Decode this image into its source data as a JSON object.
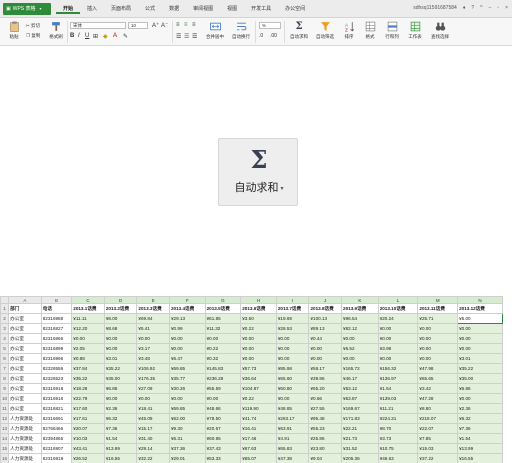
{
  "titlebar": {
    "app_name": "WPS 表格",
    "tabs": [
      "开始",
      "插入",
      "页面布局",
      "公式",
      "数据",
      "审阅视图",
      "视图",
      "开发工具",
      "办公空间"
    ],
    "active_tab": "开始",
    "right_text": "sdhsq11591687584"
  },
  "ribbon": {
    "paste": "粘贴",
    "cut": "剪切",
    "copy": "复制",
    "format_painter": "格式刷",
    "font_name": "宋体",
    "font_size": "10",
    "merge_center": "合并居中",
    "wrap_text": "自动换行",
    "number_format": "%",
    "autosum": "自动求和",
    "autofilter": "自动筛选",
    "sort": "排序",
    "format": "格式",
    "rows_cols": "行和列",
    "worksheet": "工作表",
    "find_select": "查找选择"
  },
  "zoomed_button": {
    "symbol": "Σ",
    "label": "自动求和",
    "caret": "▾"
  },
  "sheet": {
    "col_letters": [
      "A",
      "B",
      "C",
      "D",
      "E",
      "F",
      "G",
      "H",
      "I",
      "J",
      "K",
      "L",
      "M",
      "N"
    ],
    "header": [
      "部门",
      "电话",
      "2013.1话费",
      "2013.2话费",
      "2013.3话费",
      "2013.4话费",
      "2013.5话费",
      "2013.6话费",
      "2013.7话费",
      "2013.8话费",
      "2013.9话费",
      "2013.10话费",
      "2013.11话费",
      "2013.12话费"
    ],
    "rows": [
      [
        "办公室",
        "82316988",
        "¥11.11",
        "¥6.00",
        "¥69.84",
        "¥29.13",
        "¥61.85",
        "¥3.50",
        "¥19.69",
        "¥100.13",
        "¥96.54",
        "¥20.24",
        "¥25.71",
        "¥6.00"
      ],
      [
        "办公室",
        "82316827",
        "¥12.20",
        "¥8.68",
        "¥5.41",
        "¥0.99",
        "¥11.32",
        "¥0.22",
        "¥28.53",
        "¥89.13",
        "¥82.12",
        "¥0.00",
        "¥0.00",
        "¥0.00"
      ],
      [
        "办公室",
        "82316866",
        "¥0.00",
        "¥0.00",
        "¥0.00",
        "¥0.00",
        "¥0.00",
        "¥0.00",
        "¥0.00",
        "¥0.44",
        "¥0.00",
        "¥0.00",
        "¥0.00",
        "¥0.00"
      ],
      [
        "办公室",
        "82316899",
        "¥2.05",
        "¥0.00",
        "¥3.17",
        "¥0.00",
        "¥0.22",
        "¥0.00",
        "¥0.00",
        "¥0.00",
        "¥6.52",
        "¥3.98",
        "¥0.00",
        "¥0.00"
      ],
      [
        "办公室",
        "82316996",
        "¥0.88",
        "¥3.01",
        "¥3.48",
        "¥6.47",
        "¥0.32",
        "¥0.00",
        "¥0.00",
        "¥0.00",
        "¥0.00",
        "¥0.00",
        "¥0.00",
        "¥3.01"
      ],
      [
        "办公室",
        "82326559",
        "¥37.84",
        "¥35.22",
        "¥106.92",
        "¥69.85",
        "¥145.83",
        "¥57.73",
        "¥85.98",
        "¥58.17",
        "¥165.72",
        "¥156.32",
        "¥47.98",
        "¥35.22"
      ],
      [
        "办公室",
        "82326523",
        "¥35.22",
        "¥35.00",
        "¥176.35",
        "¥35.77",
        "¥236.28",
        "¥36.64",
        "¥65.60",
        "¥39.86",
        "¥46.17",
        "¥136.97",
        "¥65.65",
        "¥35.00"
      ],
      [
        "办公室",
        "82316918",
        "¥18.28",
        "¥6.86",
        "¥27.09",
        "¥30.26",
        "¥55.59",
        "¥104.87",
        "¥60.80",
        "¥65.20",
        "¥53.12",
        "¥1.54",
        "¥3.42",
        "¥6.86"
      ],
      [
        "办公室",
        "82316916",
        "¥22.79",
        "¥0.00",
        "¥0.00",
        "¥0.00",
        "¥0.00",
        "¥0.22",
        "¥0.00",
        "¥0.66",
        "¥53.87",
        "¥139.03",
        "¥47.28",
        "¥0.00"
      ],
      [
        "办公室",
        "82316821",
        "¥17.60",
        "¥2.36",
        "¥18.41",
        "¥69.85",
        "¥48.66",
        "¥119.90",
        "¥48.85",
        "¥27.55",
        "¥169.67",
        "¥11.21",
        "¥8.80",
        "¥2.36"
      ],
      [
        "人力资源处",
        "82316691",
        "¥17.61",
        "¥6.32",
        "¥45.09",
        "¥62.00",
        "¥78.50",
        "¥41.74",
        "¥263.17",
        "¥95.48",
        "¥171.83",
        "¥224.31",
        "¥218.07",
        "¥6.32"
      ],
      [
        "人力资源处",
        "82766466",
        "¥20.07",
        "¥7.36",
        "¥15.17",
        "¥9.30",
        "¥20.67",
        "¥16.41",
        "¥63.91",
        "¥55.23",
        "¥22.21",
        "¥8.70",
        "¥22.07",
        "¥7.36"
      ],
      [
        "人力资源处",
        "82394865",
        "¥10.03",
        "¥1.54",
        "¥31.40",
        "¥6.31",
        "¥60.95",
        "¥17.46",
        "¥4.91",
        "¥25.86",
        "¥21.73",
        "¥3.73",
        "¥7.85",
        "¥1.54"
      ],
      [
        "人力资源处",
        "82316907",
        "¥43.41",
        "¥13.99",
        "¥29.14",
        "¥37.36",
        "¥37.43",
        "¥67.63",
        "¥65.83",
        "¥23.80",
        "¥31.52",
        "¥10.75",
        "¥15.03",
        "¥13.99"
      ],
      [
        "人力资源处",
        "82316919",
        "¥26.52",
        "¥16.55",
        "¥32.22",
        "¥29.01",
        "¥53.33",
        "¥65.07",
        "¥47.38",
        "¥9.04",
        "¥205.36",
        "¥46.63",
        "¥37.22",
        "¥16.55"
      ]
    ],
    "active_cell_value": "¥6.00"
  }
}
